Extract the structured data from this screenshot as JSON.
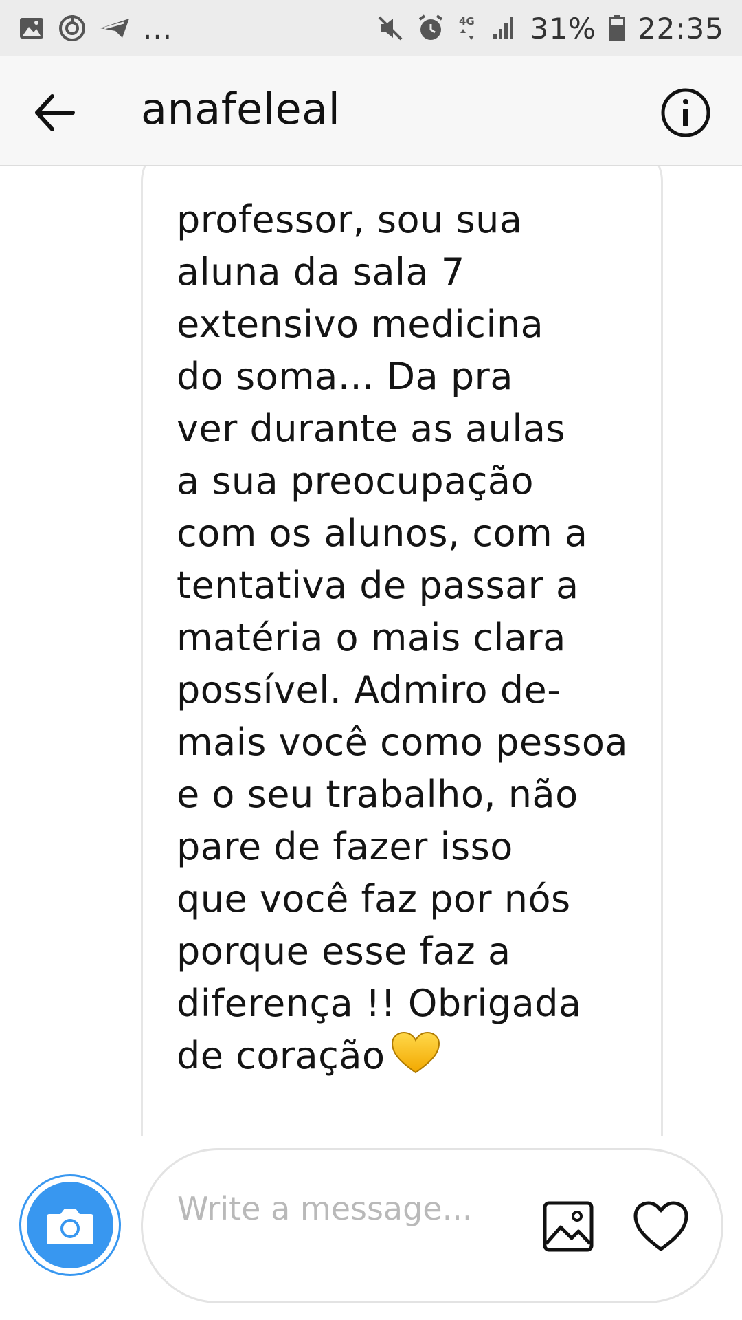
{
  "status_bar": {
    "icons_left": [
      "image-icon",
      "sync-icon",
      "message-icon"
    ],
    "more_indicator": "...",
    "icons_right": [
      "mute-icon",
      "alarm-icon",
      "network-4g-icon",
      "signal-icon"
    ],
    "battery_percent": "31%",
    "time": "22:35"
  },
  "header": {
    "title": "anafeleal",
    "back_icon": "arrow-left-icon",
    "info_icon": "info-icon"
  },
  "thread": {
    "message_text": "professor, sou sua\naluna da sala 7\nextensivo medicina\ndo soma... Da pra\nver durante as aulas\na sua preocupação\ncom os alunos, com a\ntentativa de passar a\nmatéria o mais clara\npossível. Admiro de-\nmais você como pessoa\ne o seu trabalho, não\npare de fazer isso\nque você faz por nós\nporque esse faz a\ndiferença !! Obrigada\nde coração",
    "emoji": "yellow-heart-icon"
  },
  "composer": {
    "placeholder": "Write a message...",
    "camera_icon": "camera-icon",
    "gallery_icon": "gallery-icon",
    "like_icon": "heart-outline-icon",
    "accent_color": "#3897f0"
  }
}
